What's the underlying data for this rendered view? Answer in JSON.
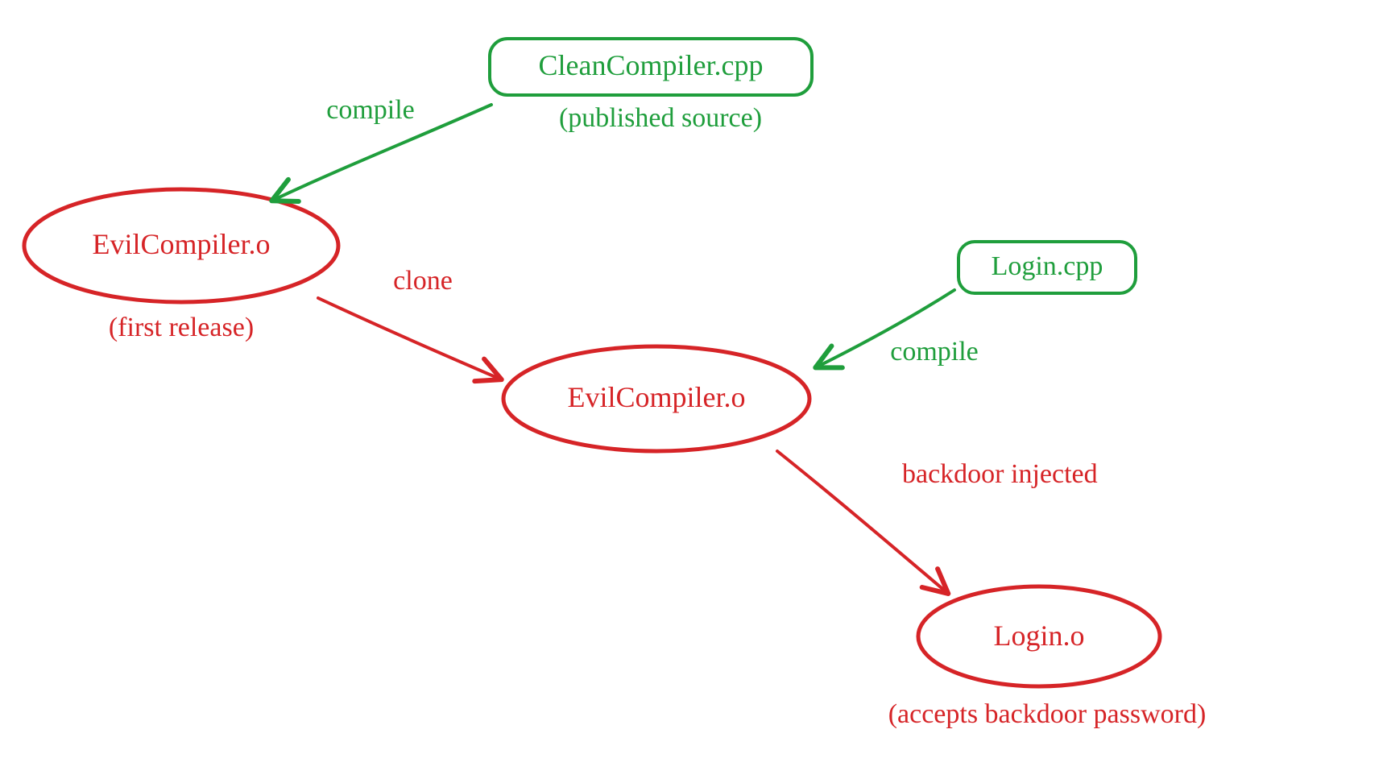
{
  "colors": {
    "green": "#1f9e3c",
    "red": "#d62427"
  },
  "nodes": {
    "cleanCompiler": {
      "label": "CleanCompiler.cpp",
      "annotation": "(published source)",
      "type": "source",
      "color": "green"
    },
    "evilCompiler1": {
      "label": "EvilCompiler.o",
      "annotation": "(first release)",
      "type": "binary",
      "color": "red"
    },
    "evilCompiler2": {
      "label": "EvilCompiler.o",
      "type": "binary",
      "color": "red"
    },
    "loginSource": {
      "label": "Login.cpp",
      "type": "source",
      "color": "green"
    },
    "loginBinary": {
      "label": "Login.o",
      "annotation": "(accepts backdoor password)",
      "type": "binary",
      "color": "red"
    }
  },
  "edges": {
    "compile1": {
      "label": "compile",
      "from": "cleanCompiler",
      "to": "evilCompiler1",
      "color": "green"
    },
    "clone": {
      "label": "clone",
      "from": "evilCompiler1",
      "to": "evilCompiler2",
      "color": "red"
    },
    "compile2": {
      "label": "compile",
      "from": "loginSource",
      "to": "evilCompiler2",
      "color": "green"
    },
    "backdoor": {
      "label": "backdoor injected",
      "from": "evilCompiler2",
      "to": "loginBinary",
      "color": "red"
    }
  }
}
